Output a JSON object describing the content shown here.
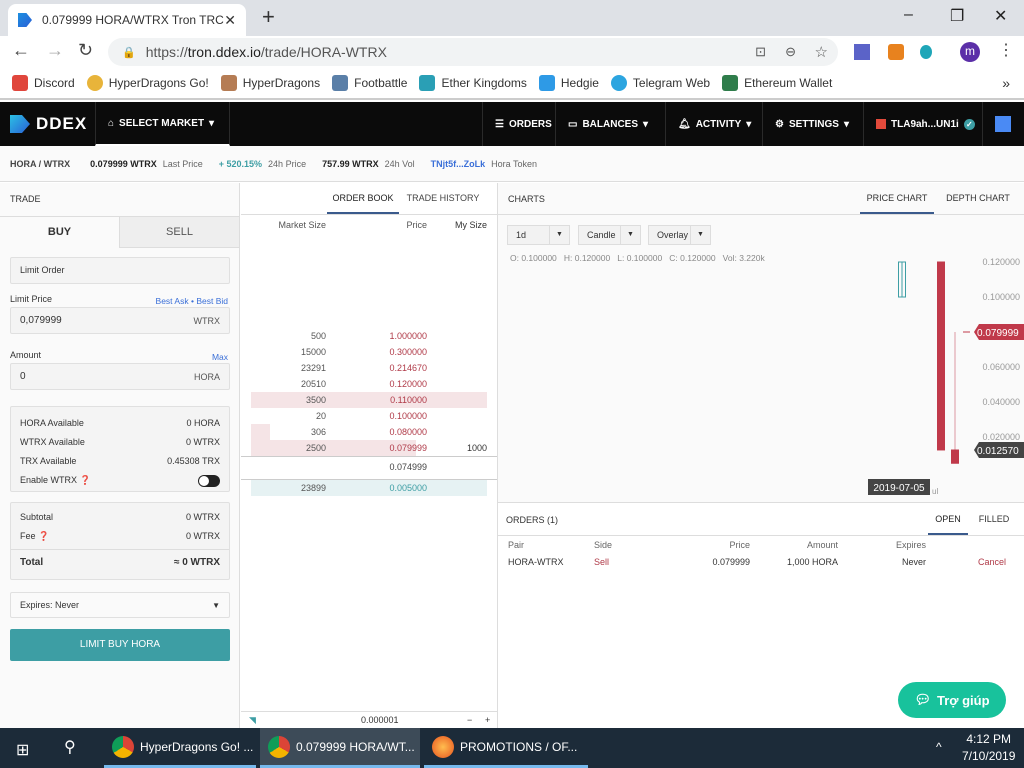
{
  "browser": {
    "tab_title": "0.079999 HORA/WTRX Tron TRC",
    "new_tab": "+",
    "url_scheme": "https://",
    "url_host": "tron.ddex.io",
    "url_path": "/trade/HORA-WTRX",
    "profile_initial": "m",
    "bookmarks": [
      {
        "label": "Discord",
        "color": "#e0463c"
      },
      {
        "label": "HyperDragons Go!",
        "color": "#e8b43a"
      },
      {
        "label": "HyperDragons",
        "color": "#b57c54"
      },
      {
        "label": "Footbattle",
        "color": "#5a7fa8"
      },
      {
        "label": "Ether Kingdoms",
        "color": "#2a9fb5"
      },
      {
        "label": "Hedgie",
        "color": "#2e9ae6"
      },
      {
        "label": "Telegram Web",
        "color": "#2ca5e0"
      },
      {
        "label": "Ethereum Wallet",
        "color": "#2f7d4b"
      }
    ],
    "more_bookmarks": "»"
  },
  "nav": {
    "logo": "DDEX",
    "select_market": "SELECT MARKET",
    "orders": "ORDERS",
    "balances": "BALANCES",
    "activity": "ACTIVITY",
    "settings": "SETTINGS",
    "account": "TLA9ah...UN1i"
  },
  "ticker": {
    "pair": "HORA / WTRX",
    "last_price": "0.079999 WTRX",
    "last_price_label": "Last Price",
    "change": "+ 520.15%",
    "change_label": "24h Price",
    "volume": "757.99 WTRX",
    "volume_label": "24h Vol",
    "token_addr": "TNjt5f...ZoLk",
    "token_name": "Hora Token",
    "accent": "#3d9ea4",
    "link": "#3a6fd8"
  },
  "trade": {
    "title": "TRADE",
    "buy_tab": "BUY",
    "sell_tab": "SELL",
    "order_type": "Limit Order",
    "limit_price_label": "Limit Price",
    "best_ask": "Best Ask",
    "dot": "•",
    "best_bid": "Best Bid",
    "limit_price": "0,079999",
    "limit_unit": "WTRX",
    "amount_label": "Amount",
    "max": "Max",
    "amount": "0",
    "amount_unit": "HORA",
    "balances": [
      {
        "label": "HORA Available",
        "value": "0 HORA"
      },
      {
        "label": "WTRX Available",
        "value": "0 WTRX"
      },
      {
        "label": "TRX Available",
        "value": "0.45308 TRX"
      }
    ],
    "enable_wtrx": "Enable WTRX",
    "enable_wtrx_on": false,
    "subtotal_label": "Subtotal",
    "subtotal": "0 WTRX",
    "fee_label": "Fee",
    "fee": "0 WTRX",
    "total_label": "Total",
    "total": "≈ 0 WTRX",
    "expires": "Expires: Never",
    "submit": "LIMIT BUY HORA",
    "button_color": "#3d9ea4"
  },
  "orderbook": {
    "tab_book": "ORDER BOOK",
    "tab_history": "TRADE HISTORY",
    "col_size": "Market Size",
    "col_price": "Price",
    "col_my": "My Size",
    "asks": [
      {
        "size": "500",
        "price": "1.000000",
        "my": ""
      },
      {
        "size": "15000",
        "price": "0.300000",
        "my": ""
      },
      {
        "size": "23291",
        "price": "0.214670",
        "my": ""
      },
      {
        "size": "20510",
        "price": "0.120000",
        "my": ""
      },
      {
        "size": "3500",
        "price": "0.110000",
        "my": ""
      },
      {
        "size": "20",
        "price": "0.100000",
        "my": ""
      },
      {
        "size": "306",
        "price": "0.080000",
        "my": ""
      },
      {
        "size": "2500",
        "price": "0.079999",
        "my": "1000"
      }
    ],
    "spread_price": "0.074999",
    "bids": [
      {
        "size": "23899",
        "price": "0.005000",
        "my": ""
      }
    ],
    "aggregation": "0.000001",
    "minus": "−",
    "plus": "+"
  },
  "charts": {
    "title": "CHARTS",
    "tab_price": "PRICE CHART",
    "tab_depth": "DEPTH CHART",
    "interval": "1d",
    "style": "Candle",
    "overlay": "Overlay",
    "ohlc": "O: 0.100000   H: 0.120000   L: 0.100000   C: 0.120000   Vol: 3.220k"
  },
  "chart_data": {
    "type": "candlestick",
    "ylim": [
      0,
      0.13
    ],
    "y_ticks": [
      "0.120000",
      "0.100000",
      "0.060000",
      "0.040000",
      "0.020000"
    ],
    "y_tick_values": [
      0.12,
      0.1,
      0.06,
      0.04,
      0.02
    ],
    "x_label_partial": "ul",
    "crosshair_date": "2019-07-05",
    "candles": [
      {
        "open": 0.1,
        "high": 0.12,
        "low": 0.1,
        "close": 0.12
      },
      {
        "open": 0.12,
        "high": 0.12,
        "low": 0.0126,
        "close": 0.0126
      },
      {
        "open": 0.01257,
        "high": 0.079999,
        "low": 0.005,
        "close": 0.005
      }
    ],
    "last_price_tag": "0.079999",
    "cursor_price_tag": "0.012570",
    "up_color": "#3d9ea4",
    "down_color": "#c0394a"
  },
  "orders": {
    "title": "ORDERS (1)",
    "tab_open": "OPEN",
    "tab_filled": "FILLED",
    "columns": [
      "Pair",
      "Side",
      "Price",
      "Amount",
      "Expires"
    ],
    "rows": [
      {
        "pair": "HORA-WTRX",
        "side": "Sell",
        "price": "0.079999",
        "amount": "1,000 HORA",
        "expires": "Never",
        "action": "Cancel"
      }
    ]
  },
  "help": {
    "label": "Trợ giúp"
  },
  "taskbar": {
    "items": [
      "HyperDragons Go! ...",
      "0.079999 HORA/WT...",
      "PROMOTIONS / OF..."
    ],
    "time": "4:12 PM",
    "date": "7/10/2019"
  }
}
